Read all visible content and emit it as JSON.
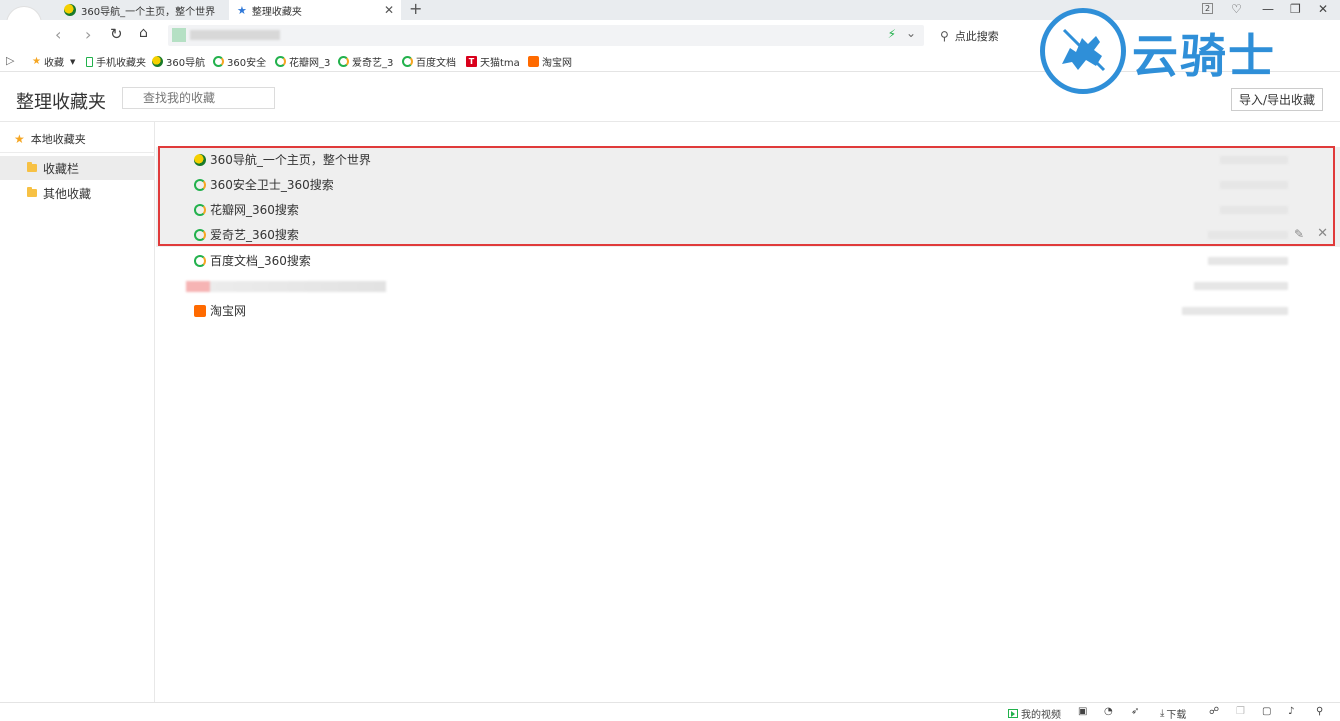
{
  "tabs": [
    {
      "label": "360导航_一个主页，整个世界",
      "icon": "360-nav-icon"
    },
    {
      "label": "整理收藏夹",
      "icon": "star-icon"
    }
  ],
  "toolbar": {
    "search_placeholder": "点此搜索"
  },
  "bookmarks_bar": {
    "collect_label": "收藏",
    "items": [
      {
        "label": "手机收藏夹",
        "icon": "phone-icon"
      },
      {
        "label": "360导航",
        "icon": "360-nav-icon"
      },
      {
        "label": "360安全",
        "icon": "360-search-icon"
      },
      {
        "label": "花瓣网_3",
        "icon": "360-search-icon"
      },
      {
        "label": "爱奇艺_3",
        "icon": "360-search-icon"
      },
      {
        "label": "百度文档",
        "icon": "360-search-icon"
      },
      {
        "label": "天猫tma",
        "icon": "tmall-icon"
      },
      {
        "label": "淘宝网",
        "icon": "taobao-icon"
      }
    ]
  },
  "page": {
    "title": "整理收藏夹",
    "search_placeholder": "查找我的收藏",
    "import_export_label": "导入/导出收藏"
  },
  "sidebar": {
    "root_label": "本地收藏夹",
    "folders": [
      {
        "label": "收藏栏",
        "selected": true
      },
      {
        "label": "其他收藏",
        "selected": false
      }
    ]
  },
  "bookmarks": [
    {
      "title": "360导航_一个主页，整个世界",
      "icon": "360-nav-icon",
      "highlighted": true
    },
    {
      "title": "360安全卫士_360搜索",
      "icon": "360-search-icon",
      "highlighted": true
    },
    {
      "title": "花瓣网_360搜索",
      "icon": "360-search-icon",
      "highlighted": true
    },
    {
      "title": "爱奇艺_360搜索",
      "icon": "360-search-icon",
      "highlighted": true
    },
    {
      "title": "百度文档_360搜索",
      "icon": "360-search-icon",
      "highlighted": false
    },
    {
      "title": "",
      "icon": "",
      "highlighted": false
    },
    {
      "title": "淘宝网",
      "icon": "taobao-icon",
      "highlighted": false
    }
  ],
  "statusbar": {
    "my_video": "我的视频",
    "download": "下载"
  },
  "watermark": {
    "text": "云骑士"
  },
  "colors": {
    "highlight_border": "#e03a3a",
    "brand_green": "#22b14c",
    "watermark_blue": "#2f8fd8",
    "folder_yellow": "#f7c144"
  }
}
